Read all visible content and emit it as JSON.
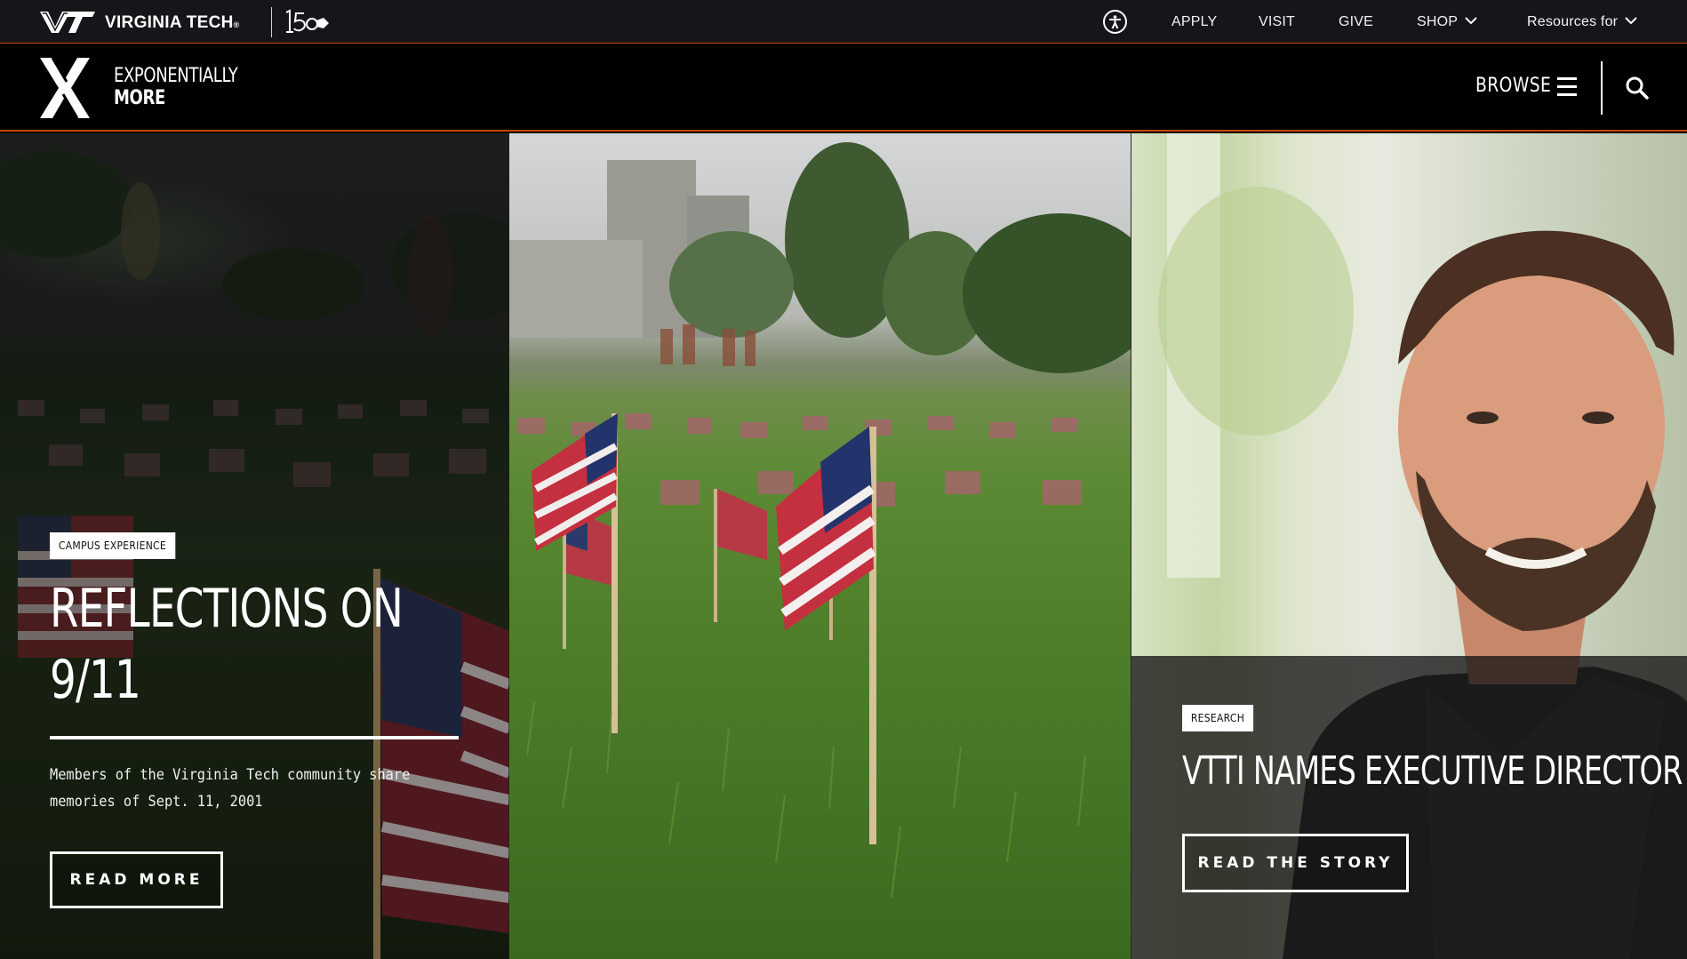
{
  "colors": {
    "accent_orange": "#c64600",
    "topbar_bg": "#16161a",
    "header_bg": "#000000",
    "text_white": "#ffffff"
  },
  "topbar": {
    "brand": "VIRGINIA TECH",
    "brand_mark": "®",
    "accessibility_icon": "accessibility-icon",
    "links": {
      "apply": "APPLY",
      "visit": "VISIT",
      "give": "GIVE",
      "shop": "SHOP",
      "resources": "Resources for"
    }
  },
  "header": {
    "tagline_line1": "EXPONENTIALLY",
    "tagline_line2": "MORE",
    "browse_label": "BROWSE",
    "menu_icon": "hamburger-icon",
    "search_icon": "search-icon"
  },
  "hero": {
    "left_story": {
      "category": "CAMPUS EXPERIENCE",
      "headline_line1": "REFLECTIONS ON",
      "headline_line2": "9/11",
      "summary_line1": "Members of the Virginia Tech community share",
      "summary_line2": "memories of Sept. 11, 2001",
      "cta": "READ MORE"
    },
    "right_story": {
      "category": "RESEARCH",
      "headline": "VTTI NAMES EXECUTIVE DIRECTOR",
      "cta": "READ THE STORY"
    }
  }
}
